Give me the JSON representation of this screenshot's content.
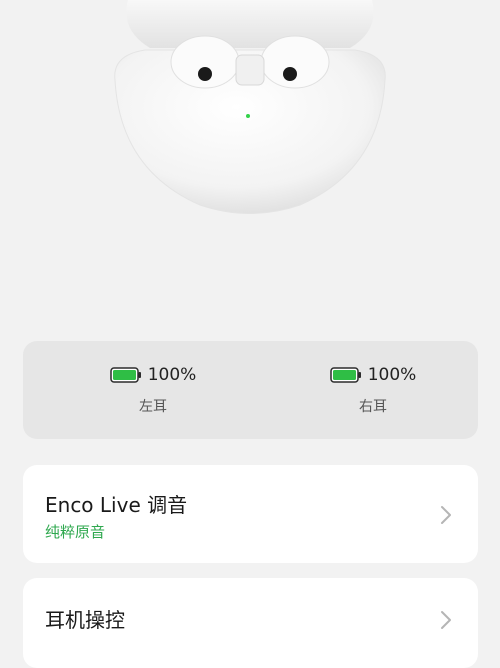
{
  "battery": {
    "left": {
      "percent_text": "100%",
      "label": "左耳",
      "level": 1.0
    },
    "right": {
      "percent_text": "100%",
      "label": "右耳",
      "level": 1.0
    }
  },
  "menu": {
    "enco_live": {
      "title": "Enco Live 调音",
      "subtitle": "纯粹原音"
    },
    "controls": {
      "title": "耳机操控"
    }
  },
  "colors": {
    "battery_green": "#2fbe45",
    "accent_green": "#2fa84f"
  }
}
